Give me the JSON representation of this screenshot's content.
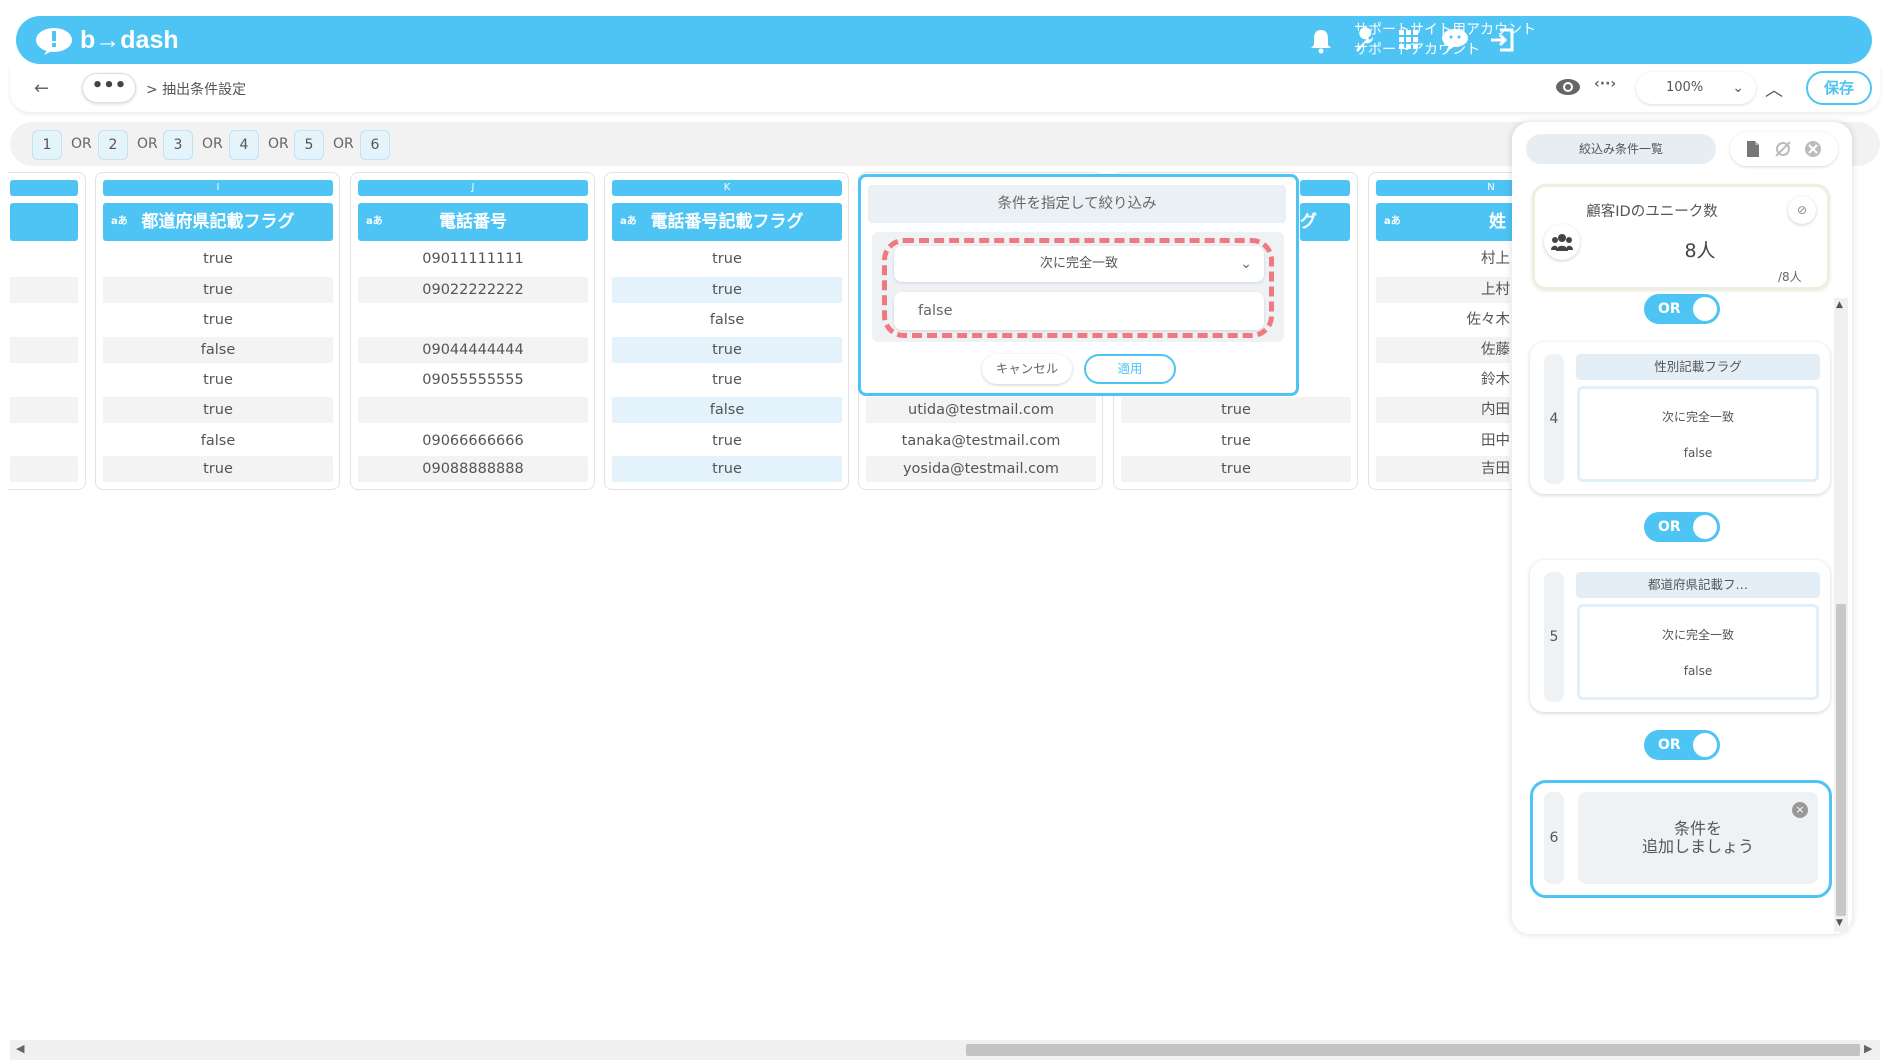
{
  "header": {
    "logo_text": "b→dash",
    "account_line1": "サポートサイト用アカウント",
    "account_line2": "サポートアカウント"
  },
  "toolbar": {
    "more_label": "•••",
    "breadcrumb": "> 抽出条件設定",
    "zoom_value": "100%",
    "save_label": "保存"
  },
  "or_groups": {
    "numbers": [
      "1",
      "2",
      "3",
      "4",
      "5",
      "6"
    ],
    "or_label": "OR"
  },
  "columns": [
    {
      "letter": "I",
      "name": "都道府県記載フラグ",
      "cells": [
        "true",
        "true",
        "true",
        "false",
        "true",
        "true",
        "false",
        "true"
      ]
    },
    {
      "letter": "J",
      "name": "電話番号",
      "cells": [
        "09011111111",
        "09022222222",
        "",
        "09044444444",
        "09055555555",
        "",
        "09066666666",
        "09088888888"
      ]
    },
    {
      "letter": "K",
      "name": "電話番号記載フラグ",
      "cells": [
        "true",
        "true",
        "false",
        "true",
        "true",
        "false",
        "true",
        "true"
      ]
    },
    {
      "letter": "",
      "name": "",
      "cells": [
        "",
        "",
        "",
        "",
        "",
        "utida@testmail.com",
        "tanaka@testmail.com",
        "yosida@testmail.com"
      ]
    },
    {
      "letter": "",
      "name": "グ",
      "cells": [
        "",
        "",
        "",
        "",
        "",
        "true",
        "true",
        "true"
      ]
    },
    {
      "letter": "N",
      "name": "姓",
      "cells": [
        "村上",
        "上村",
        "佐々木",
        "佐藤",
        "鈴木",
        "内田",
        "田中",
        "吉田"
      ]
    }
  ],
  "col_type_badge": "aあ",
  "popover": {
    "title": "条件を指定して絞り込み",
    "operator": "次に完全一致",
    "value": "false",
    "cancel_label": "キャンセル",
    "apply_label": "適用"
  },
  "panel": {
    "tab_label": "絞込み条件一覧",
    "unique_label": "顧客IDのユニーク数",
    "unique_count": "8人",
    "unique_total": "/8人",
    "or_toggle_label": "OR",
    "conditions": [
      {
        "index": "4",
        "name": "性別記載フラグ",
        "operator": "次に完全一致",
        "value": "false"
      },
      {
        "index": "5",
        "name": "都道府県記載フ…",
        "operator": "次に完全一致",
        "value": "false"
      }
    ],
    "add_index": "6",
    "add_label_line1": "条件を",
    "add_label_line2": "追加しましょう"
  },
  "colors": {
    "accent": "#4dc4f3",
    "dashed_highlight": "#f07880"
  }
}
